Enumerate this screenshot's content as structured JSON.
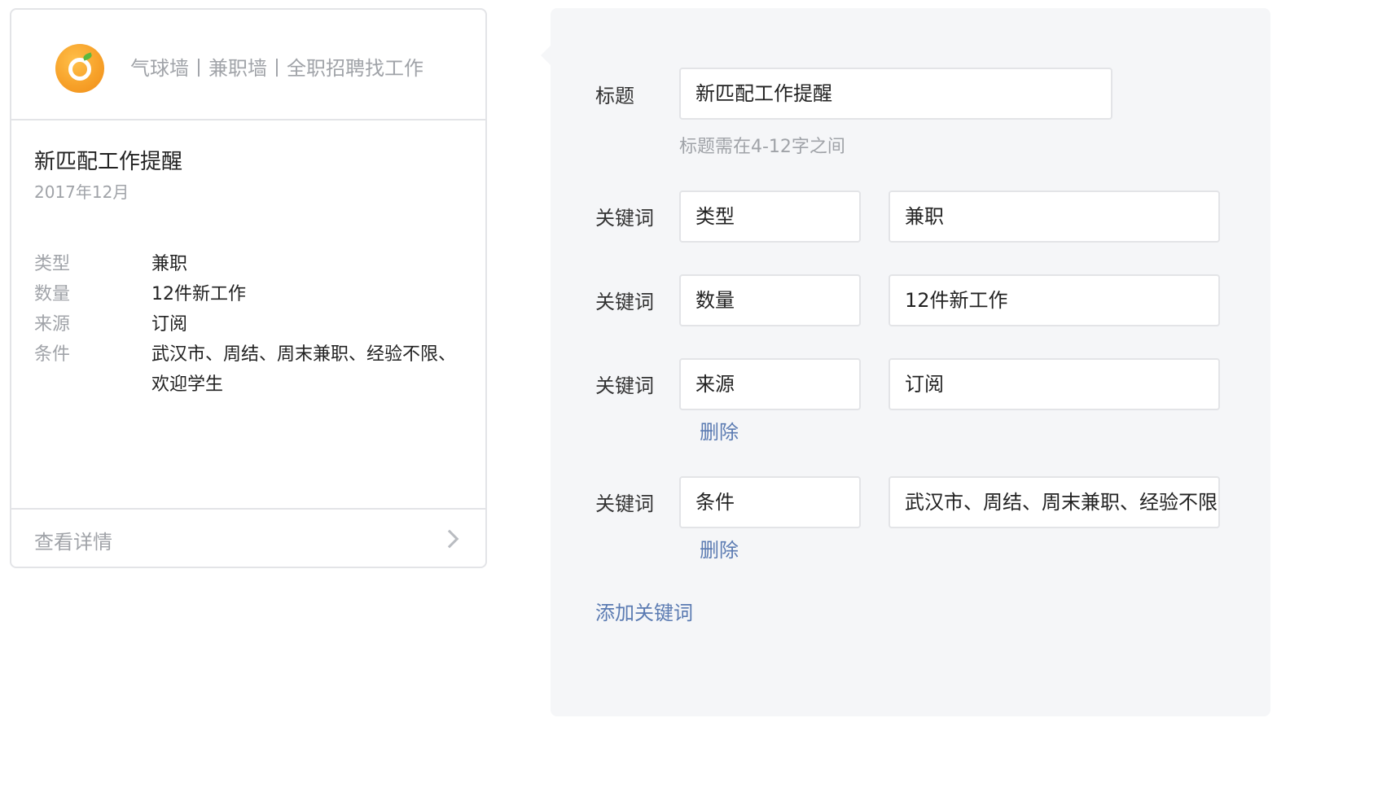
{
  "preview": {
    "account_name": "气球墙丨兼职墙丨全职招聘找工作",
    "title": "新匹配工作提醒",
    "date": "2017年12月",
    "rows": [
      {
        "key": "类型",
        "value": "兼职"
      },
      {
        "key": "数量",
        "value": "12件新工作"
      },
      {
        "key": "来源",
        "value": "订阅"
      },
      {
        "key": "条件",
        "value": "武汉市、周结、周末兼职、经验不限、欢迎学生"
      }
    ],
    "footer_label": "查看详情",
    "icons": {
      "logo": "orange-logo-icon",
      "chevron": "chevron-right-icon"
    }
  },
  "editor": {
    "title_label": "标题",
    "title_value": "新匹配工作提醒",
    "title_hint": "标题需在4-12字之间",
    "keyword_label": "关键词",
    "keywords": [
      {
        "name": "类型",
        "value": "兼职",
        "delete_label": ""
      },
      {
        "name": "数量",
        "value": "12件新工作",
        "delete_label": ""
      },
      {
        "name": "来源",
        "value": "订阅",
        "delete_label": "删除"
      },
      {
        "name": "条件",
        "value": "武汉市、周结、周末兼职、经验不限、欢迎学生",
        "delete_label": "删除"
      }
    ],
    "add_keyword_label": "添加关键词"
  },
  "colors": {
    "link": "#5b7bb2",
    "panel_bg": "#f5f6f8",
    "border": "#e3e4e7",
    "muted_text": "#a0a3a8"
  }
}
